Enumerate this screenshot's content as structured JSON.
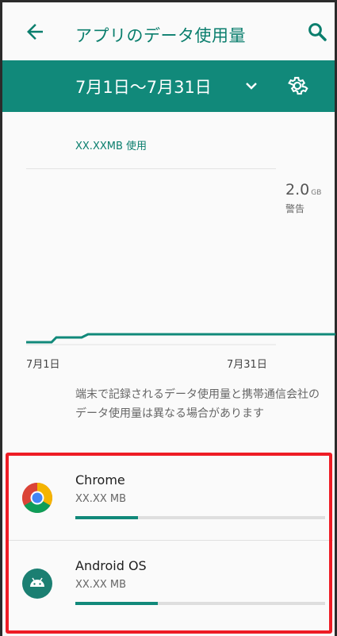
{
  "header": {
    "title": "アプリのデータ使用量",
    "back_icon": "arrow-back-icon",
    "search_icon": "search-icon"
  },
  "cycle": {
    "label": "7月1日〜7月31日",
    "dropdown_icon": "chevron-down-icon",
    "settings_icon": "gear-icon"
  },
  "usage": {
    "text": "XX.XXMB 使用"
  },
  "limit": {
    "value": "2.0",
    "unit": "GB",
    "label": "警告"
  },
  "graph": {
    "x_start_label": "7月1日",
    "x_end_label": "7月31日"
  },
  "note": "端末で記録されるデータ使用量と携帯通信会社のデータ使用量は異なる場合があります",
  "apps": [
    {
      "name": "Chrome",
      "size": "XX.XX MB",
      "usage_fraction": 0.25,
      "icon": "chrome-icon"
    },
    {
      "name": "Android OS",
      "size": "XX.XX MB",
      "usage_fraction": 0.33,
      "icon": "android-icon"
    }
  ],
  "colors": {
    "accent": "#11897a",
    "accent_text": "#0a7e6d",
    "highlight": "#ee1c25"
  }
}
